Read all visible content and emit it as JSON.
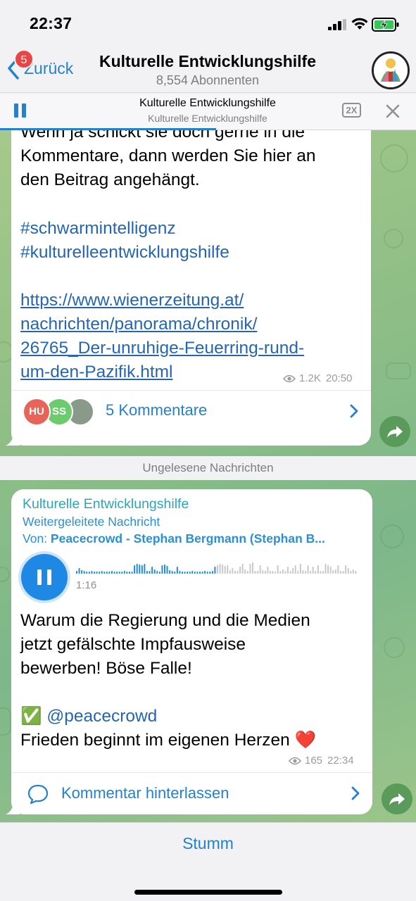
{
  "status_bar": {
    "time": "22:37"
  },
  "navbar": {
    "back_label": "Zurück",
    "badge_count": "5",
    "title": "Kulturelle Entwicklungshilfe",
    "subscribers": "8,554 Abonnenten"
  },
  "player": {
    "title": "Kulturelle Entwicklungshilfe",
    "subtitle": "Kulturelle Entwicklungshilfe",
    "speed_label": "2X",
    "progress": 0.52
  },
  "message1": {
    "text_lines": [
      "Wenn ja schickt sie doch gerne in die",
      "Kommentare, dann werden Sie hier an",
      "den Beitrag angehängt."
    ],
    "hashtags": [
      "#schwarmintelligenz",
      "#kulturelleentwicklungshilfe"
    ],
    "url_lines": [
      "https://www.wienerzeitung.at/",
      "nachrichten/panorama/chronik/",
      "26765_Der-unruhige-Feuerring-rund-",
      "um-den-Pazifik.html"
    ],
    "views": "1.2K",
    "time": "20:50",
    "commenter_avatars": [
      {
        "initials": "HU",
        "color": "#e8645a"
      },
      {
        "initials": "SS",
        "color": "#6ccb6c"
      },
      {
        "initials": "",
        "color": "#8a9a8a"
      }
    ],
    "comments_label": "5 Kommentare"
  },
  "unread_separator": "Ungelesene Nachrichten",
  "message2": {
    "channel": "Kulturelle Entwicklungshilfe",
    "forwarded_label": "Weitergeleitete Nachricht",
    "from_prefix": "Von:",
    "from_name": "Peacecrowd - Stephan Bergmann (Stephan B...",
    "audio_duration": "1:16",
    "audio_progress": 0.5,
    "text_lines": [
      "Warum die Regierung und die Medien",
      "jetzt gefälschte Impfausweise",
      "bewerben! Böse Falle!"
    ],
    "check_emoji": "✅",
    "mention": "@peacecrowd",
    "closing_line": "Frieden beginnt im eigenen Herzen",
    "heart_emoji": "❤️",
    "views": "165",
    "time": "22:34",
    "leave_comment_label": "Kommentar hinterlassen"
  },
  "bottom": {
    "mute_label": "Stumm"
  },
  "colors": {
    "accent": "#2481cc",
    "link": "#2465b4",
    "badge": "#e64646",
    "share": "#5a9a5a"
  },
  "icons": [
    "back-chevron-icon",
    "pause-icon",
    "close-icon",
    "eye-icon",
    "chevron-right-icon",
    "share-arrow-icon",
    "comment-bubble-icon",
    "signal-icon",
    "wifi-icon",
    "battery-icon"
  ]
}
